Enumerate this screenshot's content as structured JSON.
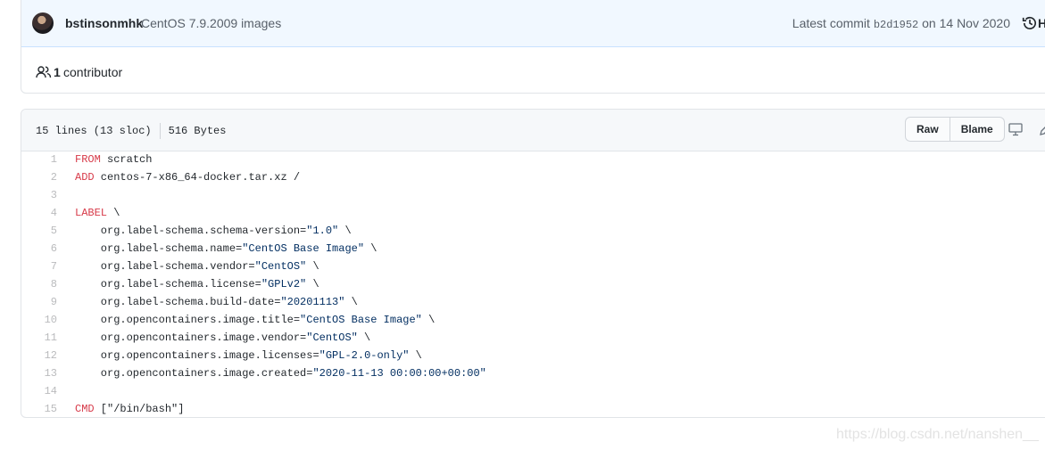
{
  "commit": {
    "author": "bstinsonmhk",
    "message": "CentOS 7.9.2009 images",
    "latest_label": "Latest commit",
    "sha": "b2d1952",
    "date_text": "on 14 Nov 2020",
    "history_label": "H"
  },
  "contributors": {
    "count": "1",
    "label": "contributor"
  },
  "file": {
    "lines_info": "15 lines (13 sloc)",
    "size": "516 Bytes",
    "raw_label": "Raw",
    "blame_label": "Blame"
  },
  "code": [
    {
      "n": "1",
      "kw": "FROM",
      "rest": " scratch",
      "str": "",
      "tail": ""
    },
    {
      "n": "2",
      "kw": "ADD",
      "rest": " centos-7-x86_64-docker.tar.xz /",
      "str": "",
      "tail": ""
    },
    {
      "n": "3",
      "kw": "",
      "rest": "",
      "str": "",
      "tail": ""
    },
    {
      "n": "4",
      "kw": "LABEL",
      "rest": " \\",
      "str": "",
      "tail": ""
    },
    {
      "n": "5",
      "kw": "",
      "rest": "    org.label-schema.schema-version=",
      "str": "\"1.0\"",
      "tail": " \\"
    },
    {
      "n": "6",
      "kw": "",
      "rest": "    org.label-schema.name=",
      "str": "\"CentOS Base Image\"",
      "tail": " \\"
    },
    {
      "n": "7",
      "kw": "",
      "rest": "    org.label-schema.vendor=",
      "str": "\"CentOS\"",
      "tail": " \\"
    },
    {
      "n": "8",
      "kw": "",
      "rest": "    org.label-schema.license=",
      "str": "\"GPLv2\"",
      "tail": " \\"
    },
    {
      "n": "9",
      "kw": "",
      "rest": "    org.label-schema.build-date=",
      "str": "\"20201113\"",
      "tail": " \\"
    },
    {
      "n": "10",
      "kw": "",
      "rest": "    org.opencontainers.image.title=",
      "str": "\"CentOS Base Image\"",
      "tail": " \\"
    },
    {
      "n": "11",
      "kw": "",
      "rest": "    org.opencontainers.image.vendor=",
      "str": "\"CentOS\"",
      "tail": " \\"
    },
    {
      "n": "12",
      "kw": "",
      "rest": "    org.opencontainers.image.licenses=",
      "str": "\"GPL-2.0-only\"",
      "tail": " \\"
    },
    {
      "n": "13",
      "kw": "",
      "rest": "    org.opencontainers.image.created=",
      "str": "\"2020-11-13 00:00:00+00:00\"",
      "tail": ""
    },
    {
      "n": "14",
      "kw": "",
      "rest": "",
      "str": "",
      "tail": ""
    },
    {
      "n": "15",
      "kw": "CMD",
      "rest": " [\"/bin/bash\"]",
      "str": "",
      "tail": ""
    }
  ],
  "watermark": "https://blog.csdn.net/nanshen__",
  "colors": {
    "keyword": "#d73a49",
    "string": "#032f62",
    "commit_bg": "#f1f8ff"
  },
  "icons": [
    "history-icon",
    "people-icon",
    "desktop-icon",
    "pencil-icon"
  ]
}
